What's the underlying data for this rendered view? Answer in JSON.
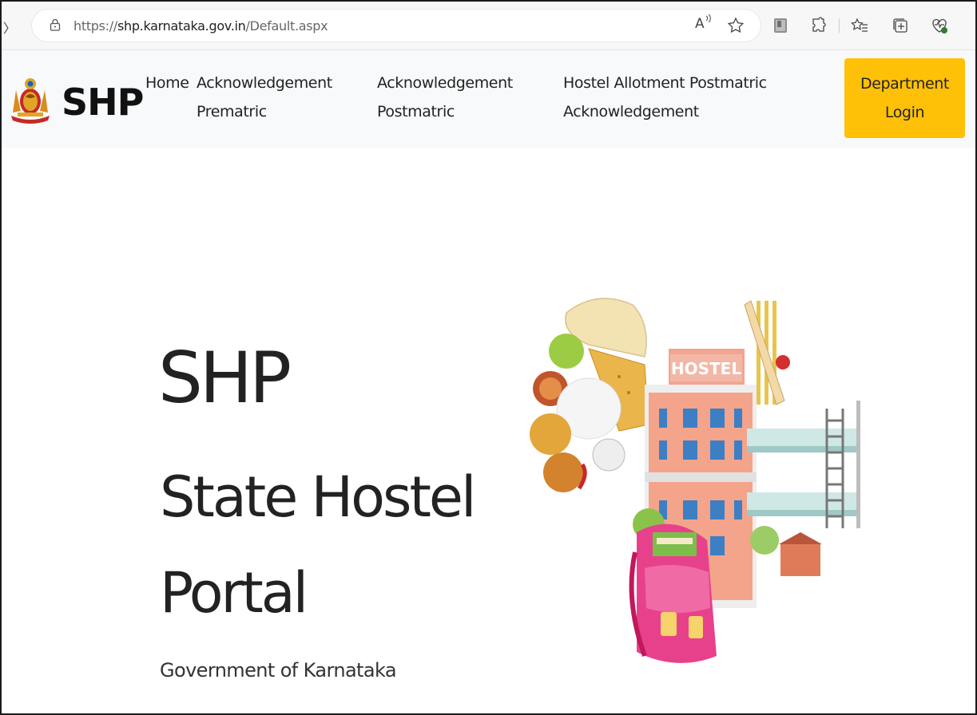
{
  "browser": {
    "url_prefix": "https://",
    "url_host": "shp.karnataka.gov.in",
    "url_path": "/Default.aspx",
    "read_aloud_label": "A",
    "icons": [
      "back-icon",
      "lock-icon",
      "read-aloud-icon",
      "favorite-star-icon",
      "profile-icon",
      "extensions-icon",
      "favorites-icon",
      "collections-icon",
      "performance-icon"
    ]
  },
  "nav": {
    "brand": "SHP",
    "links": [
      {
        "line1": "Home",
        "line2": ""
      },
      {
        "line1": "Acknowledgement",
        "line2": "Prematric"
      },
      {
        "line1": "Acknowledgement",
        "line2": "Postmatric"
      },
      {
        "line1": "Hostel Allotment Postmatric",
        "line2": "Acknowledgement"
      }
    ],
    "login": {
      "line1": "Department",
      "line2": "Login"
    },
    "login_color": "#ffc107"
  },
  "hero": {
    "title": "SHP",
    "subtitle_line1": "State Hostel",
    "subtitle_line2": "Portal",
    "government": "Government of Karnataka",
    "illustration_sign": "HOSTEL"
  }
}
